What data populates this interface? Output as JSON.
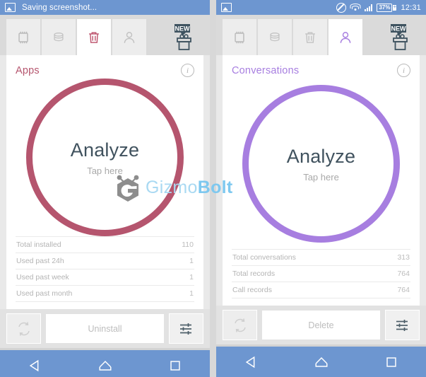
{
  "colors": {
    "status_bar": "#6d96d0",
    "nav_bar": "#6d96d0",
    "apps_accent": "#b5556e",
    "conversations_accent": "#a77ee0",
    "analyze_text": "#40525e",
    "page_background": "#d8d8d8"
  },
  "panels": [
    {
      "status_bar": {
        "left_icon": "image-icon",
        "title": "Saving screenshot...",
        "right_icons": [],
        "time": ""
      },
      "tabs": [
        {
          "name": "apps",
          "icon": "chip-icon",
          "active": false
        },
        {
          "name": "storage",
          "icon": "database-stack-icon",
          "active": false
        },
        {
          "name": "trash",
          "icon": "trash-icon",
          "active": true
        },
        {
          "name": "contacts",
          "icon": "person-icon",
          "active": false
        }
      ],
      "gift": {
        "icon": "gift-icon",
        "badge": "NEW"
      },
      "card": {
        "title": "Apps",
        "title_color": "#b5556e",
        "info_icon": "info-icon",
        "dial": {
          "primary_label": "Analyze",
          "secondary_label": "Tap here",
          "ring_color": "#b5556e"
        },
        "stats": [
          {
            "label": "Total installed",
            "value": "110"
          },
          {
            "label": "Used past 24h",
            "value": "1"
          },
          {
            "label": "Used past week",
            "value": "1"
          },
          {
            "label": "Used past month",
            "value": "1"
          }
        ]
      },
      "actions": {
        "refresh_icon": "refresh-icon",
        "primary_label": "Uninstall",
        "settings_icon": "sliders-icon"
      },
      "nav": {
        "back_icon": "back-triangle-icon",
        "home_icon": "home-icon",
        "recents_icon": "recents-square-icon"
      }
    },
    {
      "status_bar": {
        "left_icon": "image-icon",
        "title": "",
        "right_icons": [
          "do-not-disturb-icon",
          "wifi-icon",
          "signal-icon",
          "battery-icon"
        ],
        "battery_percent": "37%",
        "time": "12:31"
      },
      "tabs": [
        {
          "name": "apps",
          "icon": "chip-icon",
          "active": false
        },
        {
          "name": "storage",
          "icon": "database-stack-icon",
          "active": false
        },
        {
          "name": "trash",
          "icon": "trash-icon",
          "active": false
        },
        {
          "name": "contacts",
          "icon": "person-icon",
          "active": true
        }
      ],
      "gift": {
        "icon": "gift-icon",
        "badge": "NEW"
      },
      "card": {
        "title": "Conversations",
        "title_color": "#a77ee0",
        "info_icon": "info-icon",
        "dial": {
          "primary_label": "Analyze",
          "secondary_label": "Tap here",
          "ring_color": "#a77ee0"
        },
        "stats": [
          {
            "label": "Total conversations",
            "value": "313"
          },
          {
            "label": "Total records",
            "value": "764"
          },
          {
            "label": "Call records",
            "value": "764"
          }
        ]
      },
      "actions": {
        "refresh_icon": "refresh-icon",
        "primary_label": "Delete",
        "settings_icon": "sliders-icon"
      },
      "nav": {
        "back_icon": "back-triangle-icon",
        "home_icon": "home-icon",
        "recents_icon": "recents-square-icon"
      }
    }
  ],
  "watermark": {
    "logo_icon": "gizmobolt-hex-logo",
    "text_light": "Gizmo",
    "text_bold": "Bolt"
  }
}
